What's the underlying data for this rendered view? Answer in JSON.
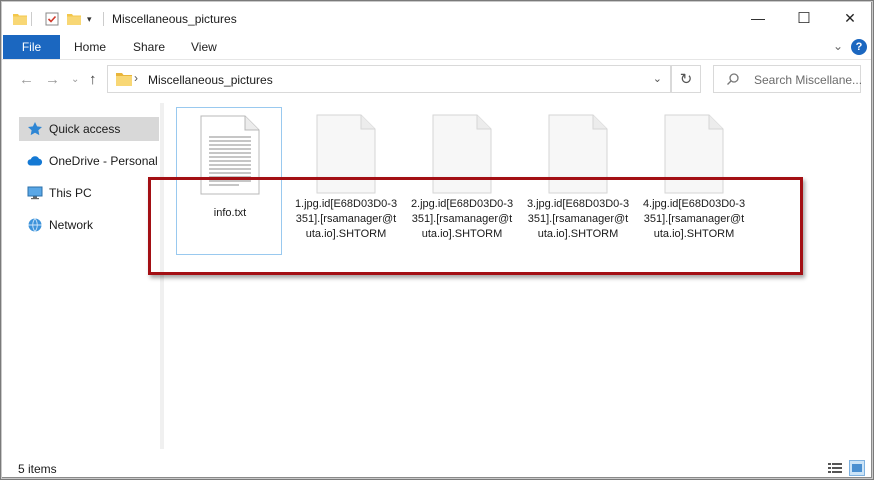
{
  "window": {
    "title": "Miscellaneous_pictures",
    "controls": {
      "minimize": "—",
      "maximize": "☐",
      "close": "✕"
    }
  },
  "ribbon": {
    "tabs": [
      "File",
      "Home",
      "Share",
      "View"
    ],
    "help": "?"
  },
  "address": {
    "path": "Miscellaneous_pictures",
    "separator": "›",
    "search_placeholder": "Search Miscellane..."
  },
  "navigation": {
    "items": [
      {
        "label": "Quick access",
        "icon": "star-icon",
        "selected": true
      },
      {
        "label": "OneDrive - Personal",
        "icon": "cloud-icon",
        "selected": false
      },
      {
        "label": "This PC",
        "icon": "computer-icon",
        "selected": false
      },
      {
        "label": "Network",
        "icon": "network-icon",
        "selected": false
      }
    ]
  },
  "files": [
    {
      "name": "info.txt",
      "type": "text",
      "selected": true
    },
    {
      "name": "1.jpg.id[E68D03D0-3351].[rsamanager@tuta.io].SHTORM",
      "type": "blank",
      "selected": false
    },
    {
      "name": "2.jpg.id[E68D03D0-3351].[rsamanager@tuta.io].SHTORM",
      "type": "blank",
      "selected": false
    },
    {
      "name": "3.jpg.id[E68D03D0-3351].[rsamanager@tuta.io].SHTORM",
      "type": "blank",
      "selected": false
    },
    {
      "name": "4.jpg.id[E68D03D0-3351].[rsamanager@tuta.io].SHTORM",
      "type": "blank",
      "selected": false
    }
  ],
  "status": {
    "item_count": "5 items"
  },
  "colors": {
    "accent": "#1b67c0",
    "highlight_box": "#a30f14",
    "folder": "#f3c74b"
  }
}
